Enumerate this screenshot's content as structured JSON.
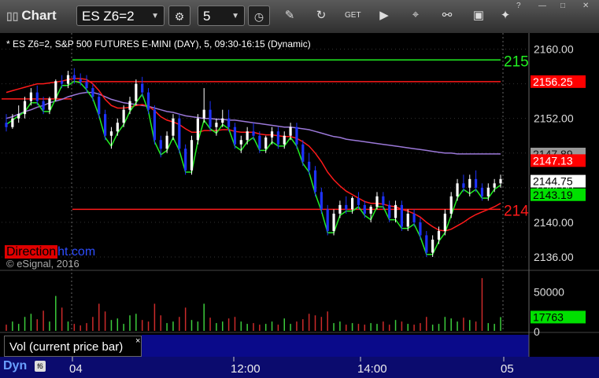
{
  "toolbar": {
    "title": "Chart",
    "symbol": "ES Z6=2",
    "interval": "5"
  },
  "chart_title": "* ES Z6=2, S&P 500 FUTURES E-MINI (DAY), 5, 09:30-16:15 (Dynamic)",
  "watermark": {
    "part1": "Direction",
    "part2": "ht.com"
  },
  "copyright": "© eSignal, 2016",
  "vol_label": "Vol (current price bar)",
  "bottom_label": "Dyn",
  "colors": {
    "up": "#ffffff",
    "down": "#1e33ff",
    "red_level": "#ff1a1a",
    "green_level": "#22ee22",
    "purple_ma": "#9b78d8",
    "volume_up": "#3ccc3c",
    "volume_down": "#cc2a2a",
    "price_tag_white": "#ffffff",
    "price_tag_green": "#00e000",
    "price_tag_red": "#ff0000"
  },
  "chart_data": {
    "type": "candlestick",
    "price_axis": {
      "ticks": [
        "2160.00",
        "2156.00",
        "2152.00",
        "2148.00",
        "2144.00",
        "2140.00",
        "2136.00"
      ],
      "ylim": [
        2135.0,
        2161.5
      ]
    },
    "time_axis": {
      "ticks": [
        "04",
        "12:00",
        "14:00",
        "05"
      ]
    },
    "levels": [
      {
        "name": "green_upper",
        "value": 2158.75,
        "color": "green",
        "label": "215"
      },
      {
        "name": "red_upper",
        "value": 2156.25,
        "color": "red",
        "label": "2156.25"
      },
      {
        "name": "red_lower",
        "value": 2141.5,
        "color": "red",
        "label": "214"
      }
    ],
    "price_tags": [
      {
        "value": "2147.89",
        "style": "gray"
      },
      {
        "value": "2147.13",
        "style": "red"
      },
      {
        "value": "2144.75",
        "style": "white"
      },
      {
        "value": "2143.19",
        "style": "green"
      }
    ],
    "candles": [
      [
        2151.5,
        2152.5,
        2150.5,
        2151.0
      ],
      [
        2151.0,
        2152.5,
        2150.8,
        2152.0
      ],
      [
        2152.0,
        2153.5,
        2151.5,
        2152.5
      ],
      [
        2152.5,
        2154.5,
        2152.0,
        2154.0
      ],
      [
        2154.0,
        2155.5,
        2153.5,
        2155.0
      ],
      [
        2155.0,
        2155.8,
        2153.5,
        2154.0
      ],
      [
        2154.0,
        2154.5,
        2152.5,
        2153.0
      ],
      [
        2153.0,
        2154.5,
        2152.5,
        2154.3
      ],
      [
        2154.3,
        2156.5,
        2154.0,
        2156.3
      ],
      [
        2156.3,
        2157.0,
        2155.5,
        2156.0
      ],
      [
        2156.0,
        2157.5,
        2155.5,
        2157.0
      ],
      [
        2157.0,
        2157.8,
        2156.0,
        2156.5
      ],
      [
        2156.5,
        2157.2,
        2155.8,
        2156.2
      ],
      [
        2156.2,
        2157.0,
        2155.0,
        2155.5
      ],
      [
        2155.5,
        2156.0,
        2154.0,
        2154.5
      ],
      [
        2154.5,
        2155.0,
        2152.0,
        2152.5
      ],
      [
        2152.5,
        2153.0,
        2149.5,
        2150.0
      ],
      [
        2150.0,
        2151.0,
        2148.5,
        2150.5
      ],
      [
        2150.5,
        2152.0,
        2150.0,
        2151.5
      ],
      [
        2151.5,
        2153.5,
        2151.0,
        2153.0
      ],
      [
        2153.0,
        2154.5,
        2152.5,
        2154.0
      ],
      [
        2154.0,
        2156.5,
        2153.5,
        2156.0
      ],
      [
        2156.0,
        2156.8,
        2154.5,
        2155.0
      ],
      [
        2155.0,
        2155.5,
        2152.5,
        2153.0
      ],
      [
        2153.0,
        2153.5,
        2149.0,
        2149.5
      ],
      [
        2149.5,
        2150.0,
        2147.5,
        2148.5
      ],
      [
        2148.5,
        2150.5,
        2148.0,
        2150.0
      ],
      [
        2150.0,
        2152.5,
        2149.5,
        2152.0
      ],
      [
        2152.0,
        2152.5,
        2148.0,
        2148.5
      ],
      [
        2148.5,
        2149.0,
        2145.5,
        2146.0
      ],
      [
        2146.0,
        2150.0,
        2145.5,
        2149.5
      ],
      [
        2149.5,
        2152.5,
        2149.0,
        2152.0
      ],
      [
        2152.0,
        2155.5,
        2151.5,
        2153.0
      ],
      [
        2153.0,
        2154.0,
        2150.5,
        2151.0
      ],
      [
        2151.0,
        2152.0,
        2150.0,
        2151.5
      ],
      [
        2151.5,
        2153.0,
        2151.0,
        2152.0
      ],
      [
        2152.0,
        2153.0,
        2150.5,
        2151.0
      ],
      [
        2151.0,
        2151.5,
        2148.5,
        2149.0
      ],
      [
        2149.0,
        2150.0,
        2148.0,
        2149.5
      ],
      [
        2149.5,
        2151.0,
        2149.0,
        2150.5
      ],
      [
        2150.5,
        2151.5,
        2149.5,
        2150.0
      ],
      [
        2150.0,
        2150.5,
        2148.0,
        2148.5
      ],
      [
        2148.5,
        2150.0,
        2148.0,
        2149.8
      ],
      [
        2149.8,
        2151.0,
        2149.0,
        2150.5
      ],
      [
        2150.5,
        2151.0,
        2148.5,
        2149.0
      ],
      [
        2149.0,
        2150.5,
        2148.5,
        2150.0
      ],
      [
        2150.0,
        2151.5,
        2149.5,
        2151.0
      ],
      [
        2151.0,
        2151.5,
        2148.5,
        2149.0
      ],
      [
        2149.0,
        2149.5,
        2146.5,
        2147.0
      ],
      [
        2147.0,
        2148.0,
        2145.5,
        2146.0
      ],
      [
        2146.0,
        2146.5,
        2143.0,
        2143.5
      ],
      [
        2143.5,
        2144.0,
        2141.0,
        2141.5
      ],
      [
        2141.5,
        2142.0,
        2138.5,
        2139.0
      ],
      [
        2139.0,
        2141.5,
        2138.5,
        2141.0
      ],
      [
        2141.0,
        2142.5,
        2140.5,
        2142.0
      ],
      [
        2142.0,
        2143.0,
        2141.0,
        2141.5
      ],
      [
        2141.5,
        2143.0,
        2141.0,
        2142.8
      ],
      [
        2142.8,
        2143.5,
        2141.5,
        2142.0
      ],
      [
        2142.0,
        2142.5,
        2140.5,
        2141.0
      ],
      [
        2141.0,
        2142.0,
        2140.0,
        2141.8
      ],
      [
        2141.8,
        2143.5,
        2141.5,
        2143.0
      ],
      [
        2143.0,
        2143.5,
        2141.5,
        2142.0
      ],
      [
        2142.0,
        2142.5,
        2140.0,
        2140.5
      ],
      [
        2140.5,
        2142.5,
        2140.0,
        2142.0
      ],
      [
        2142.0,
        2142.5,
        2139.0,
        2139.5
      ],
      [
        2139.5,
        2141.5,
        2139.0,
        2141.0
      ],
      [
        2141.0,
        2141.5,
        2139.5,
        2140.0
      ],
      [
        2140.0,
        2140.5,
        2138.0,
        2138.5
      ],
      [
        2138.5,
        2139.0,
        2136.0,
        2136.5
      ],
      [
        2136.5,
        2138.5,
        2136.0,
        2138.0
      ],
      [
        2138.0,
        2139.5,
        2137.5,
        2139.0
      ],
      [
        2139.0,
        2141.5,
        2138.5,
        2141.0
      ],
      [
        2141.0,
        2143.5,
        2140.5,
        2143.0
      ],
      [
        2143.0,
        2145.0,
        2142.5,
        2144.5
      ],
      [
        2144.5,
        2145.5,
        2143.5,
        2144.0
      ],
      [
        2144.0,
        2145.5,
        2143.0,
        2145.0
      ],
      [
        2145.0,
        2146.0,
        2143.5,
        2144.0
      ],
      [
        2144.0,
        2144.5,
        2142.5,
        2143.0
      ],
      [
        2143.0,
        2144.5,
        2142.5,
        2144.0
      ],
      [
        2144.0,
        2145.0,
        2143.5,
        2144.5
      ],
      [
        2144.5,
        2145.5,
        2144.0,
        2145.0
      ]
    ],
    "ma_red": [
      2155.0,
      2155.2,
      2155.4,
      2155.6,
      2155.8,
      2156.0,
      2156.0,
      2156.1,
      2156.2,
      2156.3,
      2156.5,
      2156.6,
      2156.6,
      2156.5,
      2156.0,
      2155.2,
      2154.2,
      2153.5,
      2153.2,
      2153.2,
      2153.3,
      2153.5,
      2153.6,
      2153.4,
      2152.9,
      2152.2,
      2151.8,
      2151.6,
      2151.3,
      2150.8,
      2150.4,
      2150.4,
      2150.6,
      2150.6,
      2150.6,
      2150.7,
      2150.7,
      2150.5,
      2150.4,
      2150.4,
      2150.4,
      2150.2,
      2150.1,
      2150.1,
      2150.0,
      2149.9,
      2149.9,
      2149.7,
      2149.3,
      2148.8,
      2148.0,
      2147.0,
      2145.8,
      2144.9,
      2144.2,
      2143.6,
      2143.2,
      2142.8,
      2142.4,
      2142.2,
      2142.2,
      2142.1,
      2141.9,
      2141.8,
      2141.5,
      2141.3,
      2141.0,
      2140.6,
      2140.0,
      2139.5,
      2139.1,
      2139.0,
      2139.2,
      2139.6,
      2140.0,
      2140.5,
      2140.9,
      2141.2,
      2141.5,
      2141.8,
      2142.2
    ],
    "ma_purple": [
      2152.0,
      2152.2,
      2152.5,
      2152.8,
      2153.0,
      2153.3,
      2153.5,
      2153.8,
      2154.0,
      2154.2,
      2154.5,
      2154.7,
      2154.9,
      2155.0,
      2155.0,
      2154.8,
      2154.5,
      2154.2,
      2154.0,
      2153.8,
      2153.7,
      2153.6,
      2153.5,
      2153.4,
      2153.2,
      2153.0,
      2152.8,
      2152.7,
      2152.5,
      2152.3,
      2152.2,
      2152.1,
      2152.0,
      2152.0,
      2151.9,
      2151.9,
      2151.8,
      2151.8,
      2151.7,
      2151.6,
      2151.5,
      2151.4,
      2151.3,
      2151.2,
      2151.1,
      2151.0,
      2151.0,
      2150.9,
      2150.8,
      2150.7,
      2150.5,
      2150.3,
      2150.1,
      2149.9,
      2149.8,
      2149.6,
      2149.5,
      2149.4,
      2149.3,
      2149.2,
      2149.1,
      2149.0,
      2148.9,
      2148.8,
      2148.7,
      2148.6,
      2148.5,
      2148.4,
      2148.3,
      2148.2,
      2148.1,
      2148.0,
      2148.0,
      2147.9,
      2147.9,
      2147.9,
      2147.9,
      2147.9,
      2147.9,
      2147.9,
      2147.9
    ],
    "volume": {
      "ticks": [
        "50000",
        "0"
      ],
      "current": "17763",
      "ylim": [
        0,
        75000
      ],
      "values": [
        8000,
        12000,
        9000,
        18000,
        22000,
        15000,
        26000,
        12000,
        45000,
        30000,
        12000,
        9000,
        7000,
        10000,
        18000,
        35000,
        25000,
        14000,
        16000,
        9000,
        20000,
        22000,
        14000,
        12000,
        35000,
        20000,
        10000,
        12000,
        18000,
        30000,
        14000,
        12000,
        35000,
        17000,
        10000,
        12000,
        16000,
        18000,
        12000,
        9000,
        10000,
        8000,
        9000,
        12000,
        8000,
        16000,
        9000,
        12000,
        15000,
        22000,
        20000,
        18000,
        25000,
        10000,
        12000,
        8000,
        10000,
        9000,
        8000,
        10000,
        9000,
        12000,
        8000,
        14000,
        12000,
        9000,
        8000,
        10000,
        18000,
        8000,
        9000,
        18000,
        16000,
        12000,
        17000,
        14000,
        12000,
        68000,
        10000,
        9000,
        17763
      ]
    }
  }
}
